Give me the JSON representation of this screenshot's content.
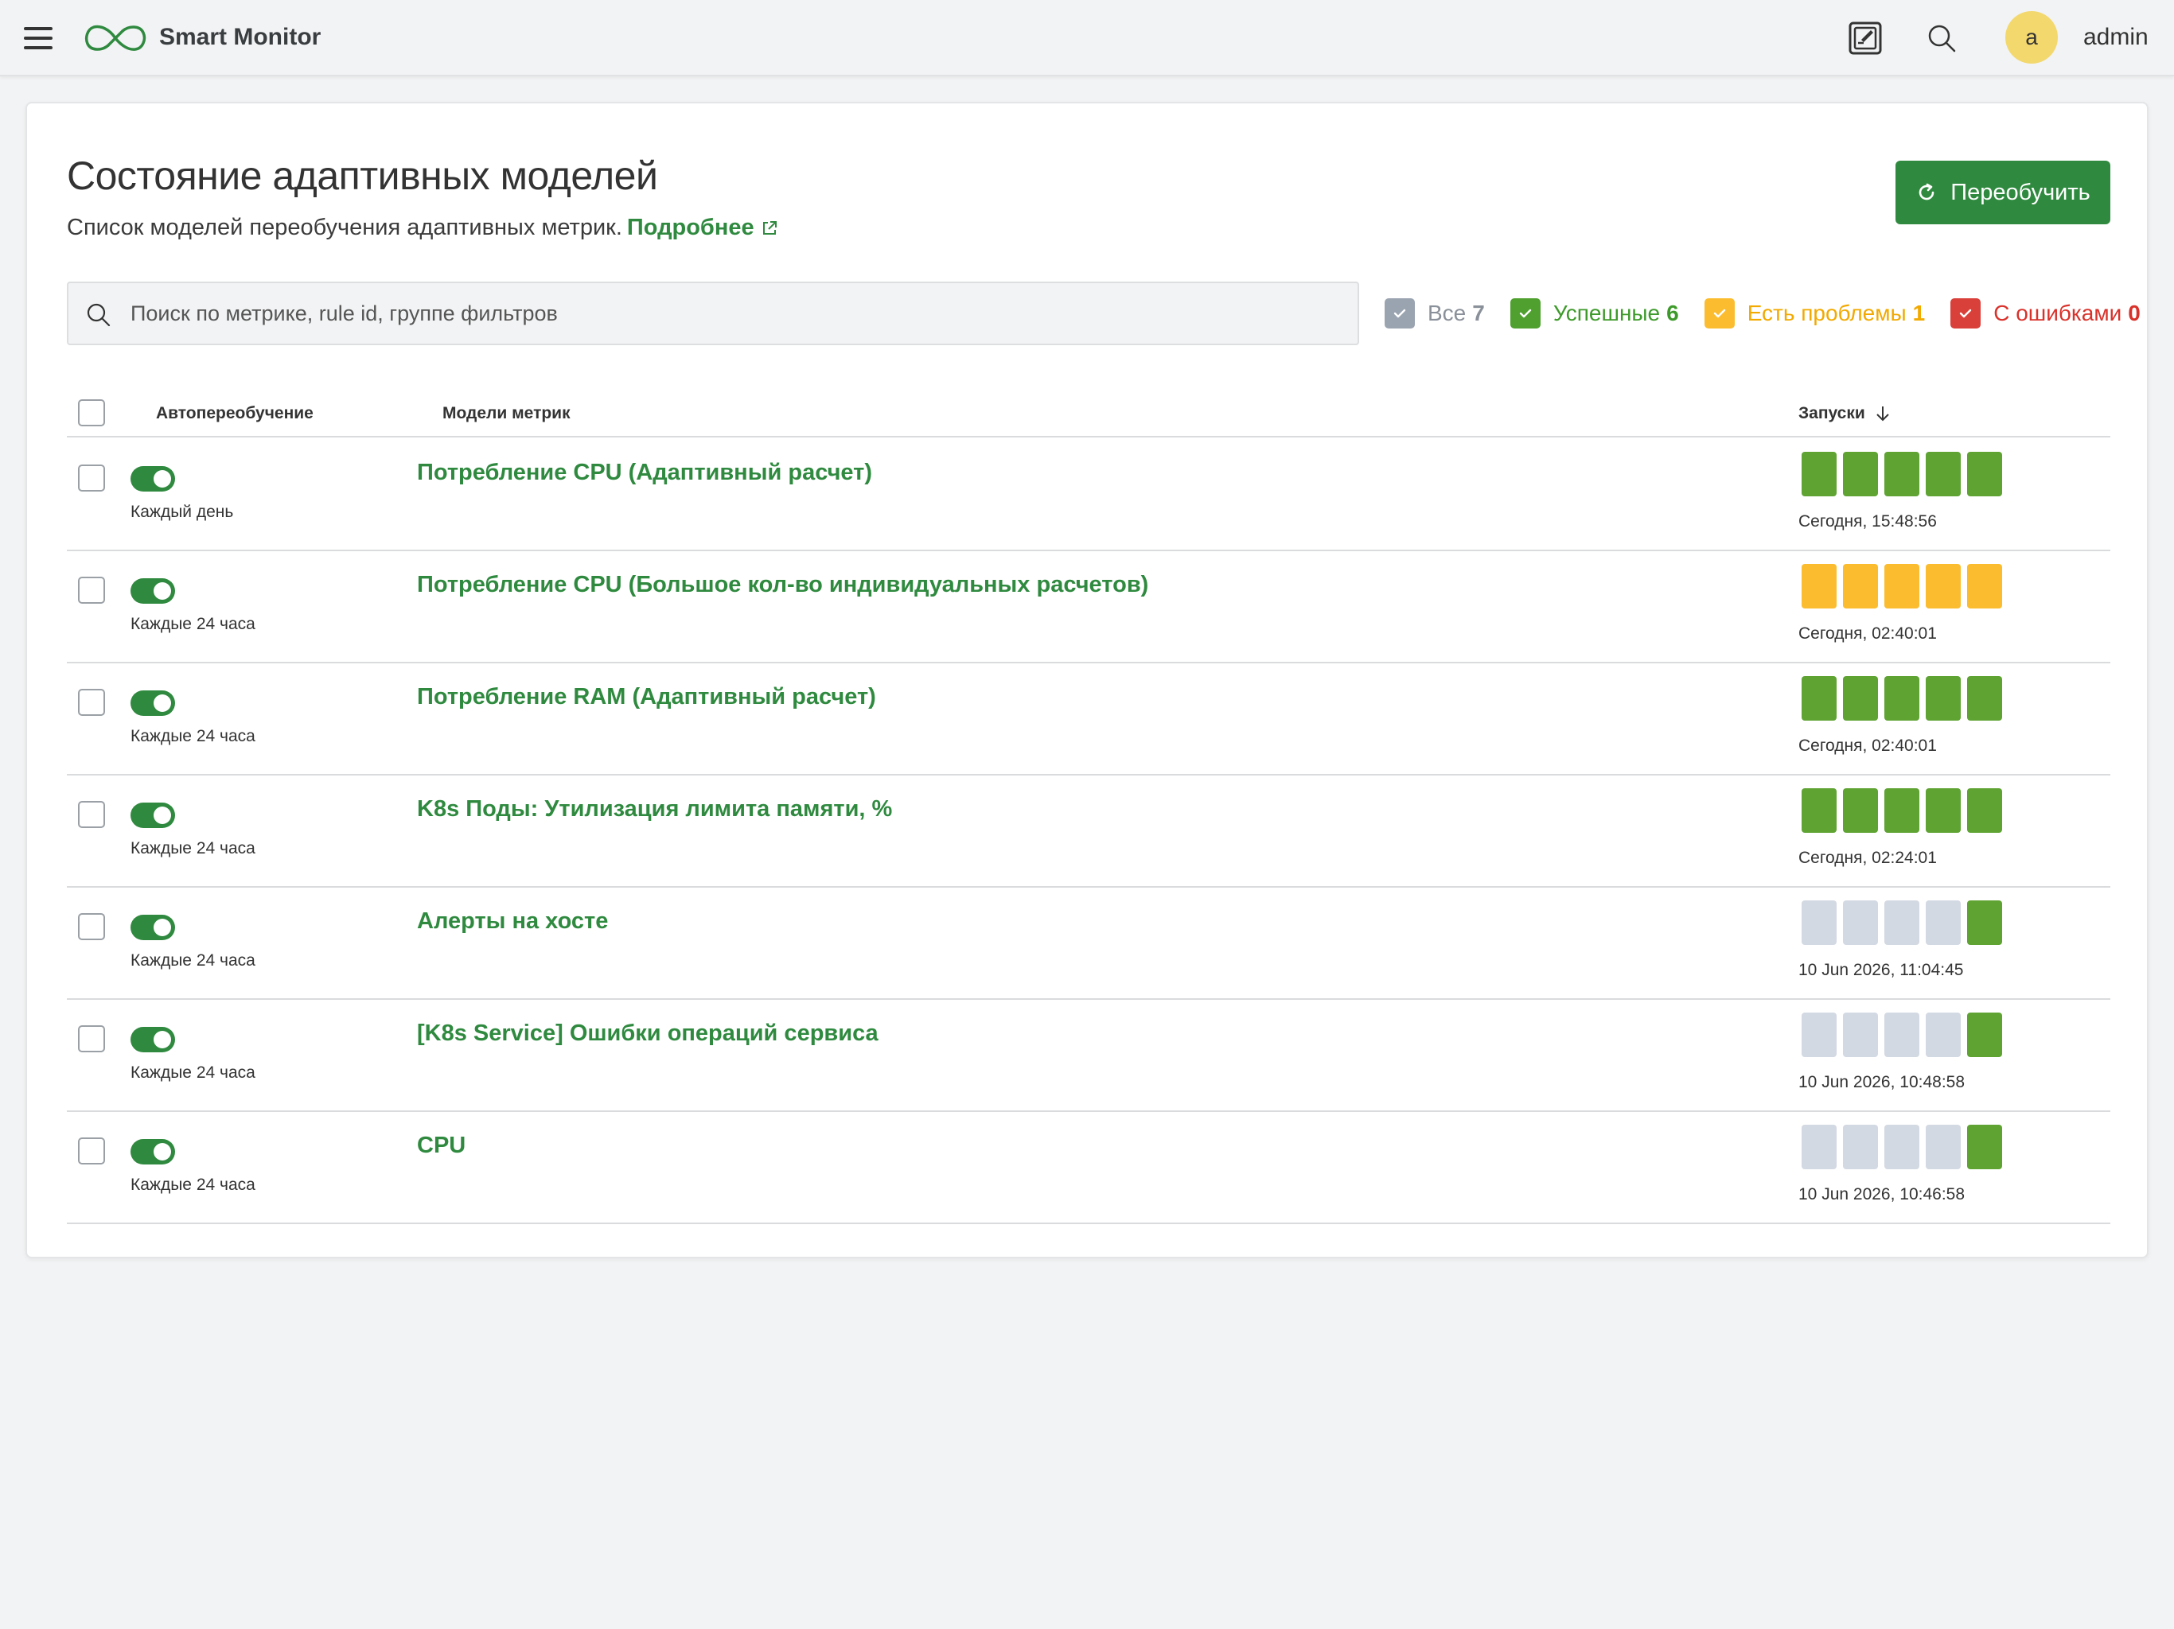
{
  "colors": {
    "accent": "#2f8a3f",
    "run_success": "#5fa333",
    "run_warning": "#fbbd2f",
    "run_error": "#d9403a",
    "run_empty": "#d3d9e2"
  },
  "topbar": {
    "brand": "Smart Monitor",
    "icons": [
      "menu-icon",
      "logo-infinity-icon",
      "edit-note-icon",
      "search-icon"
    ],
    "avatar_letter": "a",
    "username": "admin"
  },
  "page": {
    "title": "Состояние адаптивных моделей",
    "subtitle": "Список моделей переобучения адаптивных метрик.",
    "more_link": "Подробнее",
    "retrain_button": "Переобучить"
  },
  "search": {
    "placeholder": "Поиск по метрике, rule id, группе фильтров"
  },
  "filters": [
    {
      "label": "Все",
      "count": "7",
      "color": "#8a9099",
      "box": "#9aa3b0"
    },
    {
      "label": "Успешные",
      "count": "6",
      "color": "#3d9a2a",
      "box": "#4fa02e"
    },
    {
      "label": "Есть проблемы",
      "count": "1",
      "color": "#f2a900",
      "box": "#fbbd2f"
    },
    {
      "label": "С ошибками",
      "count": "0",
      "color": "#d9322b",
      "box": "#d9403a"
    }
  ],
  "table": {
    "headers": {
      "auto": "Автопереобучение",
      "models": "Модели метрик",
      "runs": "Запуски"
    },
    "rows": [
      {
        "schedule": "Каждый день",
        "name": "Потребление CPU (Адаптивный расчет)",
        "runs": [
          "success",
          "success",
          "success",
          "success",
          "success"
        ],
        "last_run": "Сегодня, 15:48:56"
      },
      {
        "schedule": "Каждые 24 часа",
        "name": "Потребление CPU (Большое кол-во индивидуальных расчетов)",
        "runs": [
          "warning",
          "warning",
          "warning",
          "warning",
          "warning"
        ],
        "last_run": "Сегодня, 02:40:01"
      },
      {
        "schedule": "Каждые 24 часа",
        "name": "Потребление RAM (Адаптивный расчет)",
        "runs": [
          "success",
          "success",
          "success",
          "success",
          "success"
        ],
        "last_run": "Сегодня, 02:40:01"
      },
      {
        "schedule": "Каждые 24 часа",
        "name": "K8s Поды: Утилизация лимита памяти, %",
        "runs": [
          "success",
          "success",
          "success",
          "success",
          "success"
        ],
        "last_run": "Сегодня, 02:24:01"
      },
      {
        "schedule": "Каждые 24 часа",
        "name": "Алерты на хосте",
        "runs": [
          "empty",
          "empty",
          "empty",
          "empty",
          "success"
        ],
        "last_run": "10 Jun 2026, 11:04:45"
      },
      {
        "schedule": "Каждые 24 часа",
        "name": "[K8s Service] Ошибки операций сервиса",
        "runs": [
          "empty",
          "empty",
          "empty",
          "empty",
          "success"
        ],
        "last_run": "10 Jun 2026, 10:48:58"
      },
      {
        "schedule": "Каждые 24 часа",
        "name": "CPU",
        "runs": [
          "empty",
          "empty",
          "empty",
          "empty",
          "success"
        ],
        "last_run": "10 Jun 2026, 10:46:58"
      }
    ]
  }
}
